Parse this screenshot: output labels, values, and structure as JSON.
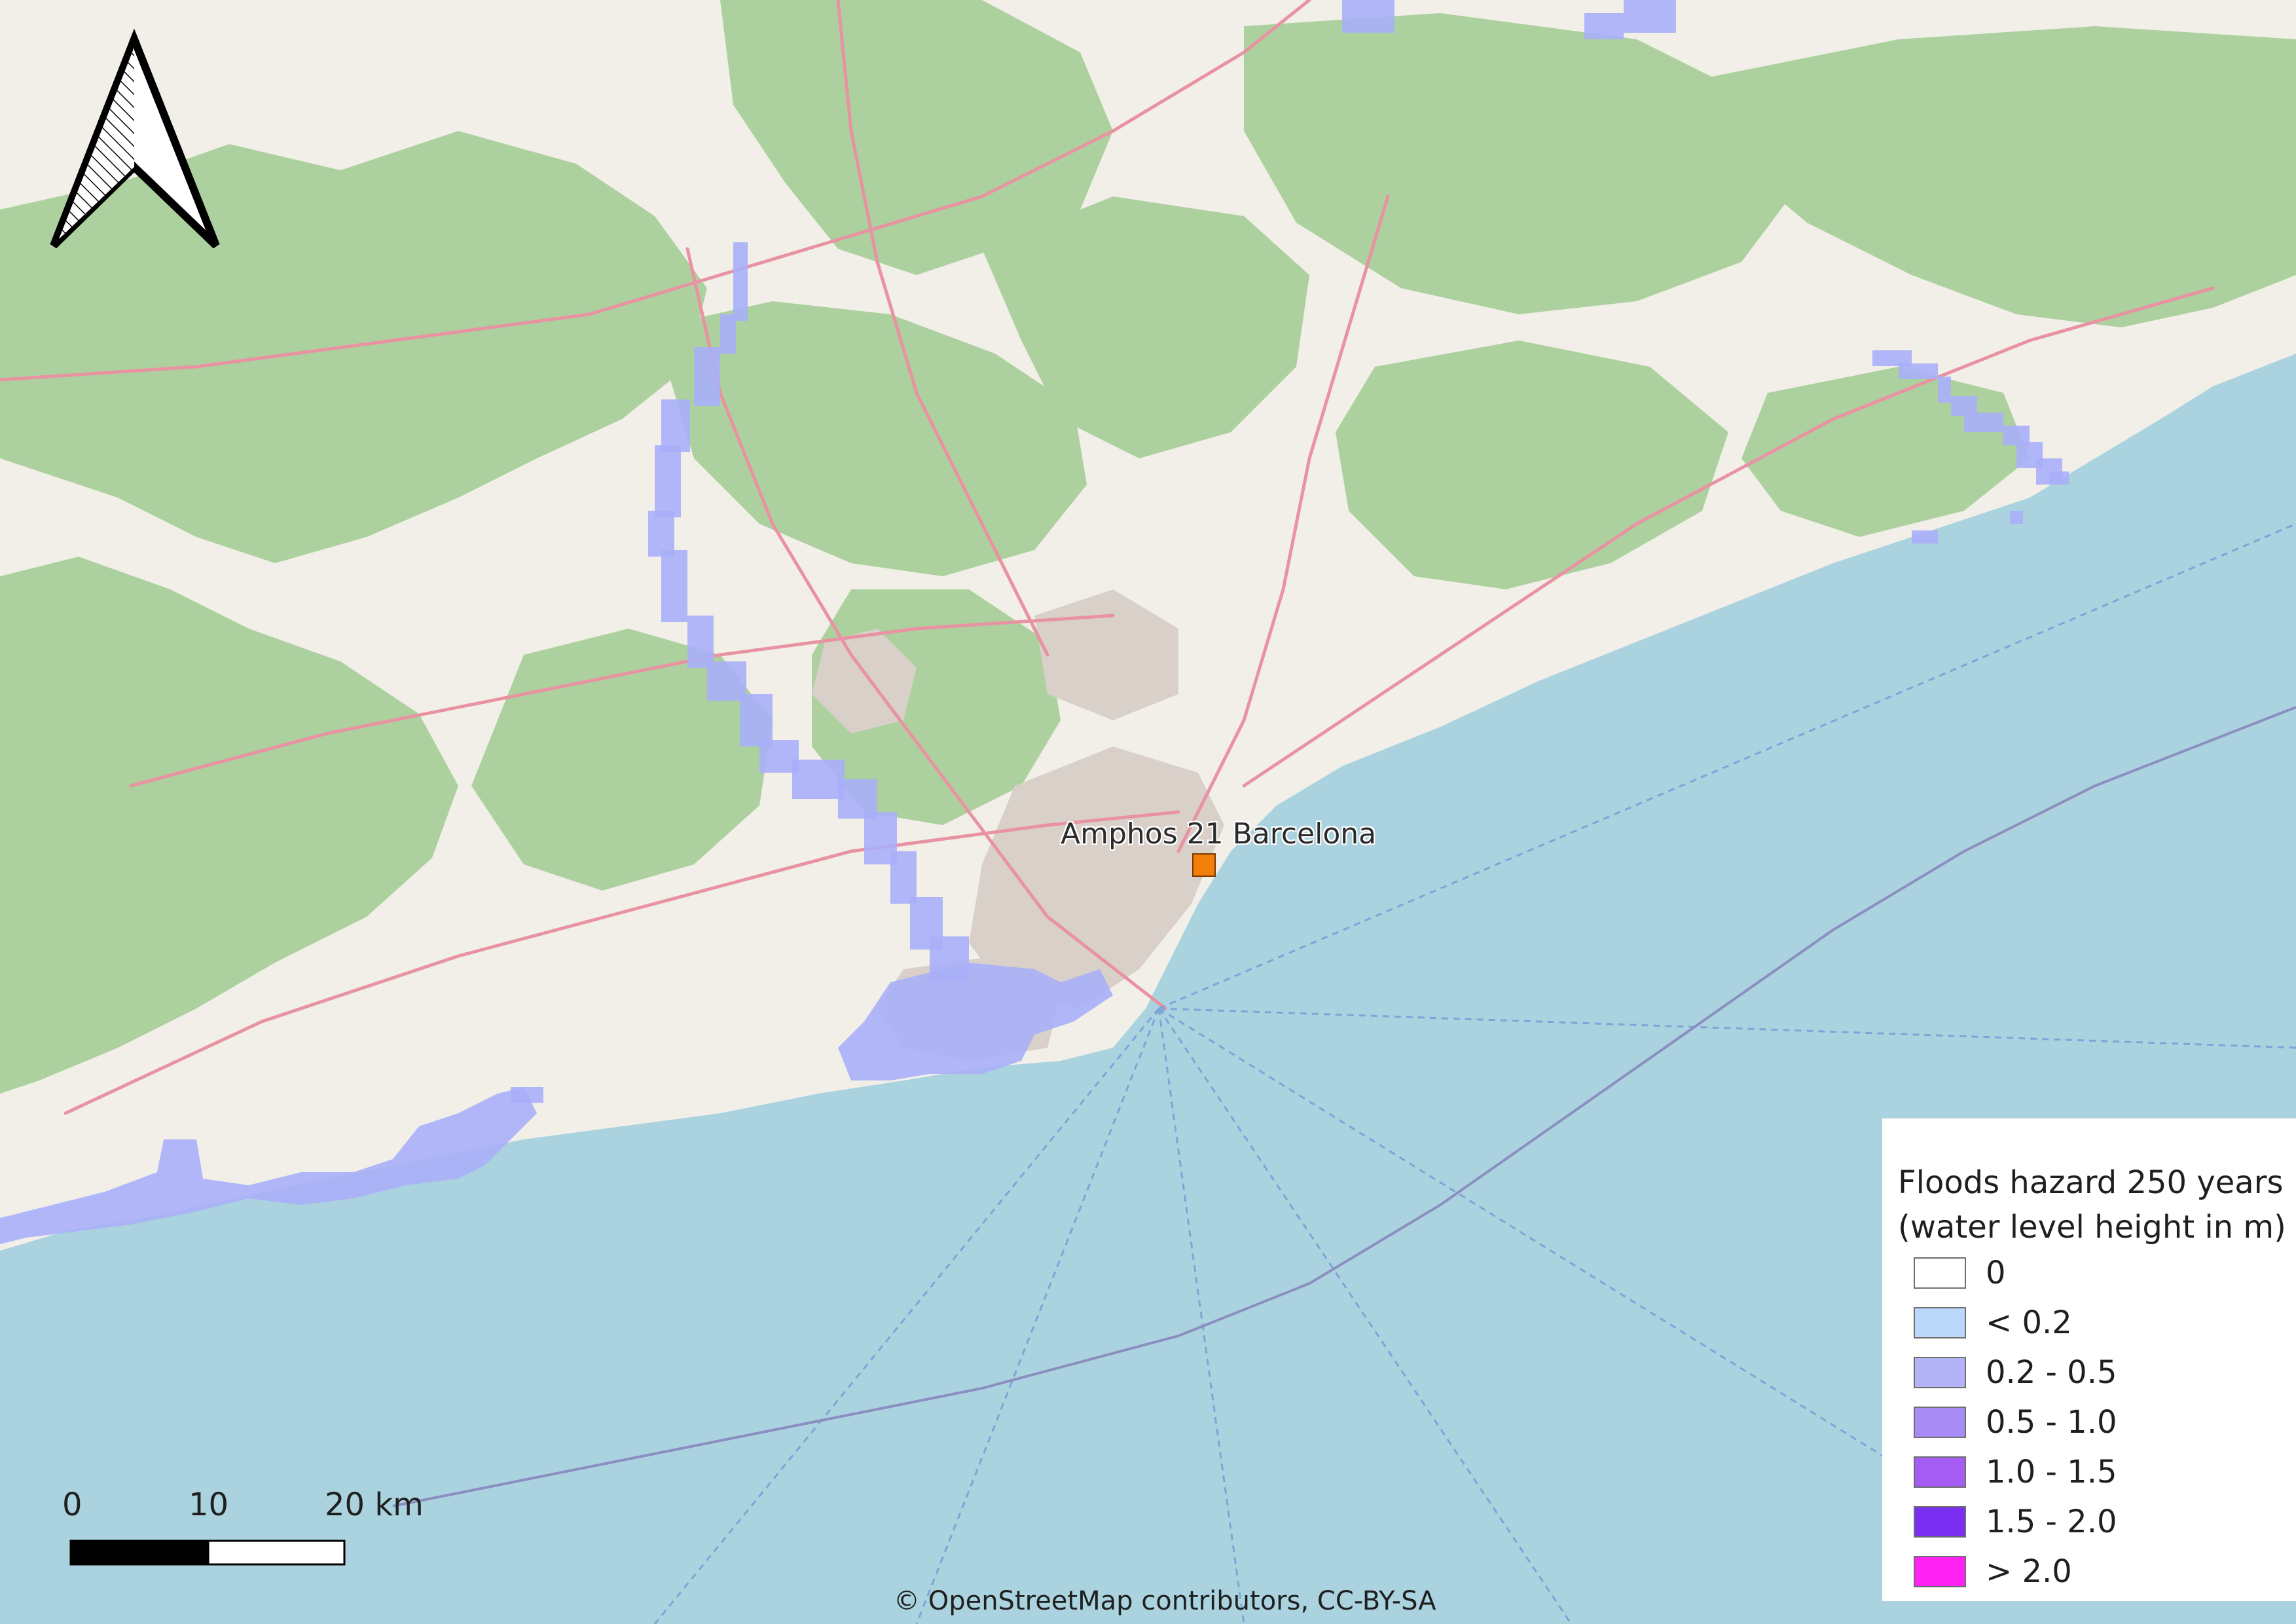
{
  "map": {
    "basemap": "OpenStreetMap",
    "colors": {
      "sea": "#aad3df",
      "land": "#f2efe9",
      "forest": "#add19e",
      "urban": "#d9d0c9",
      "road": "#e892a2",
      "flood_low": "#a9aff8"
    }
  },
  "north_arrow": {
    "icon": "north-arrow-icon"
  },
  "place": {
    "label": "Amphos 21 Barcelona",
    "color": "#f27f0c"
  },
  "legend": {
    "title_line1": "Floods hazard 250 years",
    "title_line2": "(water level height in m)",
    "items": [
      {
        "label": "0",
        "color": "#ffffff"
      },
      {
        "label": "< 0.2",
        "color": "#b9d8fa"
      },
      {
        "label": "0.2 - 0.5",
        "color": "#b3b4f7"
      },
      {
        "label": "0.5 - 1.0",
        "color": "#a98bf6"
      },
      {
        "label": "1.0 - 1.5",
        "color": "#a55cf2"
      },
      {
        "label": "1.5 - 2.0",
        "color": "#7a2ef2"
      },
      {
        "label": "> 2.0",
        "color": "#ff22f2"
      }
    ]
  },
  "scale_bar": {
    "label_0": "0",
    "label_10": "10",
    "label_20": "20 km"
  },
  "attribution": "© OpenStreetMap contributors, CC-BY-SA"
}
